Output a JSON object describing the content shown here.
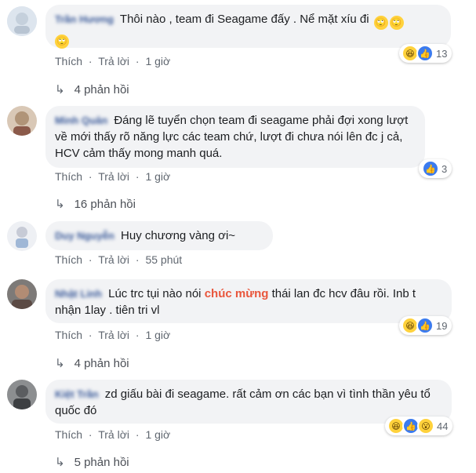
{
  "labels": {
    "like": "Thích",
    "reply": "Trả lời",
    "sep": "·"
  },
  "comments": [
    {
      "author": "Trần Hương",
      "text": "Thôi nào , team đi Seagame đấy . Nể mặt xíu đi",
      "time": "1 giờ",
      "reaction_count": "13",
      "replies": "4 phản hồi"
    },
    {
      "author": "Minh Quân",
      "text": "Đáng lẽ tuyển chọn team đi seagame phải đợi xong lượt về mới thấy rõ năng lực các team chứ, lượt đi chưa nói lên đc j cả, HCV cảm thấy mong manh quá.",
      "time": "1 giờ",
      "reaction_count": "3",
      "replies": "16 phản hồi"
    },
    {
      "author": "Duy Nguyễn",
      "text": "Huy chương vàng ơi~",
      "time": "55 phút"
    },
    {
      "author": "Nhật Linh",
      "text_before": "Lúc trc tụi nào nói",
      "text_highlight": "chúc mừng",
      "text_after": "thái lan đc hcv đâu rồi. Inb t nhận 1lay . tiên tri vl",
      "time": "1 giờ",
      "reaction_count": "19",
      "replies": "4 phản hồi"
    },
    {
      "author": "Kiệt Trần",
      "text": "zd giấu bài đi seagame. rất cảm ơn các bạn vì tình thần yêu tổ quốc đó",
      "time": "1 giờ",
      "reaction_count": "44",
      "replies": "5 phản hồi"
    }
  ],
  "colors": {
    "author": "#385898",
    "bubble": "#f2f3f5",
    "highlight": "#e9563c",
    "like": "#3b7bef"
  }
}
